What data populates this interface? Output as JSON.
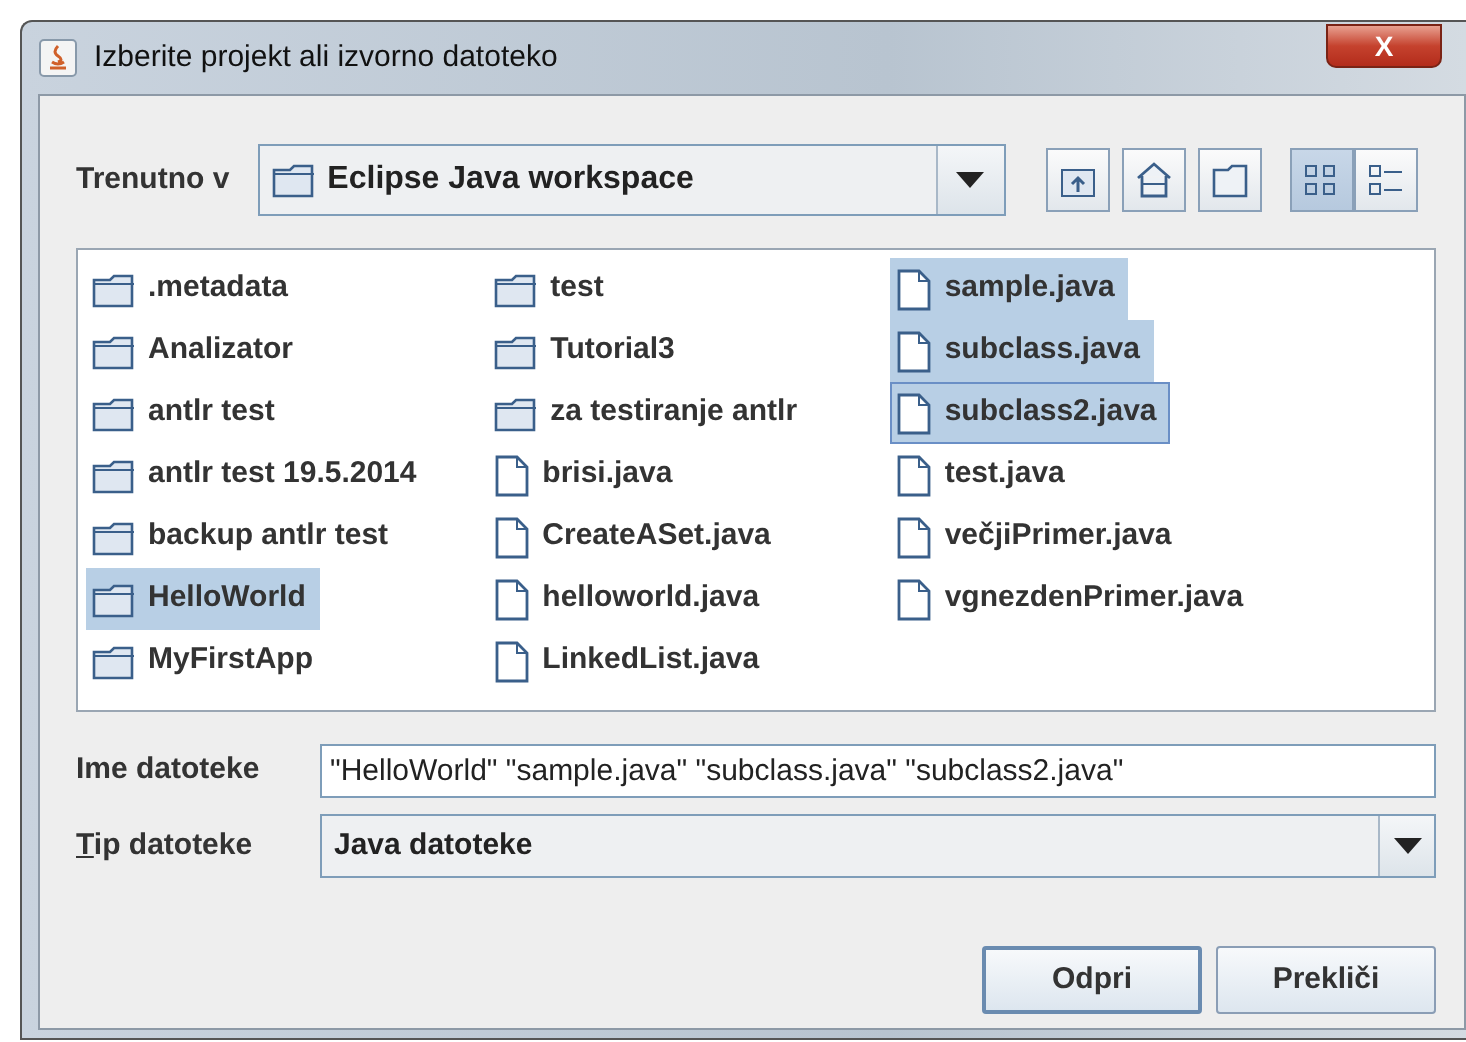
{
  "window": {
    "title": "Izberite projekt ali izvorno datoteko",
    "close": "X"
  },
  "location": {
    "label": "Trenutno v",
    "value": "Eclipse Java workspace"
  },
  "view_buttons": [
    {
      "kind": "up",
      "selected": false
    },
    {
      "kind": "home",
      "selected": false
    },
    {
      "kind": "new-folder",
      "selected": false
    },
    {
      "kind": "list",
      "selected": true
    },
    {
      "kind": "details",
      "selected": false
    }
  ],
  "columns": [
    {
      "items": [
        {
          "kind": "folder",
          "name": ".metadata",
          "selected": false,
          "focused": false
        },
        {
          "kind": "folder",
          "name": "Analizator",
          "selected": false,
          "focused": false
        },
        {
          "kind": "folder",
          "name": "antlr test",
          "selected": false,
          "focused": false
        },
        {
          "kind": "folder",
          "name": "antlr test 19.5.2014",
          "selected": false,
          "focused": false
        },
        {
          "kind": "folder",
          "name": "backup antlr test",
          "selected": false,
          "focused": false
        },
        {
          "kind": "folder",
          "name": "HelloWorld",
          "selected": true,
          "focused": false
        },
        {
          "kind": "folder",
          "name": "MyFirstApp",
          "selected": false,
          "focused": false
        }
      ]
    },
    {
      "items": [
        {
          "kind": "folder",
          "name": "test",
          "selected": false,
          "focused": false
        },
        {
          "kind": "folder",
          "name": "Tutorial3",
          "selected": false,
          "focused": false
        },
        {
          "kind": "folder",
          "name": "za testiranje antlr",
          "selected": false,
          "focused": false
        },
        {
          "kind": "file",
          "name": "brisi.java",
          "selected": false,
          "focused": false
        },
        {
          "kind": "file",
          "name": "CreateASet.java",
          "selected": false,
          "focused": false
        },
        {
          "kind": "file",
          "name": "helloworld.java",
          "selected": false,
          "focused": false
        },
        {
          "kind": "file",
          "name": "LinkedList.java",
          "selected": false,
          "focused": false
        }
      ]
    },
    {
      "items": [
        {
          "kind": "file",
          "name": "sample.java",
          "selected": true,
          "focused": false
        },
        {
          "kind": "file",
          "name": "subclass.java",
          "selected": true,
          "focused": false
        },
        {
          "kind": "file",
          "name": "subclass2.java",
          "selected": true,
          "focused": true
        },
        {
          "kind": "file",
          "name": "test.java",
          "selected": false,
          "focused": false
        },
        {
          "kind": "file",
          "name": "večjiPrimer.java",
          "selected": false,
          "focused": false
        },
        {
          "kind": "file",
          "name": "vgnezdenPrimer.java",
          "selected": false,
          "focused": false
        }
      ]
    }
  ],
  "file_name": {
    "label": "Ime datoteke",
    "value": "\"HelloWorld\" \"sample.java\" \"subclass.java\" \"subclass2.java\""
  },
  "file_type": {
    "label": "Tip datoteke",
    "mnemonic_underlined": true,
    "value": "Java datoteke"
  },
  "buttons": [
    {
      "label": "Odpri",
      "default": true
    },
    {
      "label": "Prekliči",
      "default": false
    }
  ]
}
